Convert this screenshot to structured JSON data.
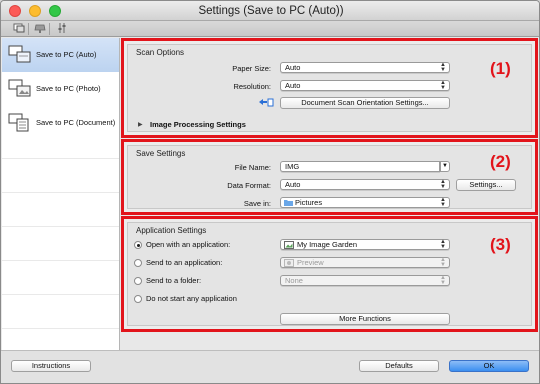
{
  "window": {
    "title": "Settings (Save to PC (Auto))"
  },
  "sidebar": {
    "items": [
      {
        "label": "Save to PC (Auto)",
        "selected": true
      },
      {
        "label": "Save to PC (Photo)",
        "selected": false
      },
      {
        "label": "Save to PC (Document)",
        "selected": false
      }
    ]
  },
  "scan_options": {
    "title": "Scan Options",
    "marker": "(1)",
    "paper_size_label": "Paper Size:",
    "paper_size_value": "Auto",
    "resolution_label": "Resolution:",
    "resolution_value": "Auto",
    "orientation_button": "Document Scan Orientation Settings...",
    "image_processing": "Image Processing Settings"
  },
  "save_settings": {
    "title": "Save Settings",
    "marker": "(2)",
    "file_name_label": "File Name:",
    "file_name_value": "IMG",
    "data_format_label": "Data Format:",
    "data_format_value": "Auto",
    "settings_button": "Settings...",
    "save_in_label": "Save in:",
    "save_in_value": "Pictures"
  },
  "application_settings": {
    "title": "Application Settings",
    "marker": "(3)",
    "options": [
      {
        "label": "Open with an application:",
        "selected": true
      },
      {
        "label": "Send to an application:",
        "selected": false
      },
      {
        "label": "Send to a folder:",
        "selected": false
      },
      {
        "label": "Do not start any application",
        "selected": false
      }
    ],
    "open_app_value": "My Image Garden",
    "send_app_value": "Preview",
    "send_folder_value": "None",
    "more_functions_button": "More Functions"
  },
  "footer": {
    "instructions_button": "Instructions",
    "defaults_button": "Defaults",
    "ok_button": "OK"
  }
}
